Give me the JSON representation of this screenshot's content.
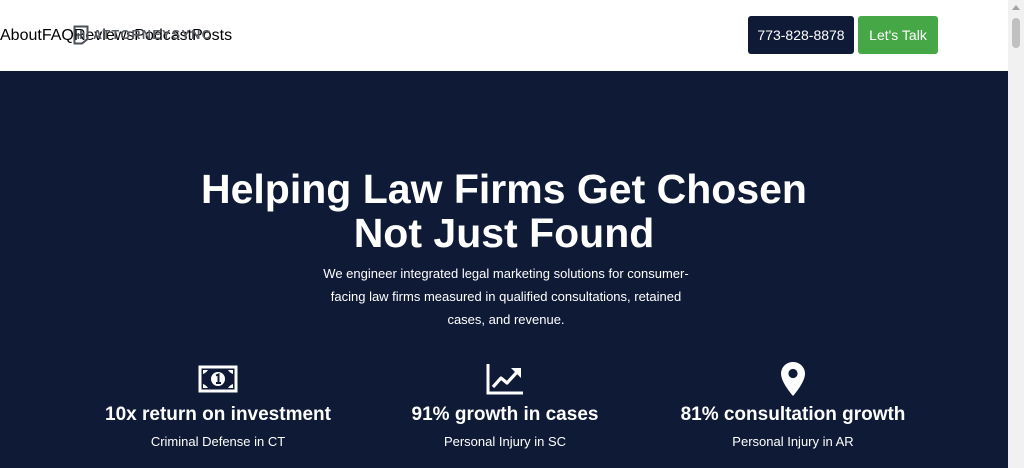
{
  "header": {
    "logo_text": "ATTORNEYSYNC",
    "nav": [
      "About",
      "FAQ",
      "Reviews",
      "Podcast",
      "Posts"
    ],
    "phone_button": "773-828-8878",
    "cta_button": "Let's Talk"
  },
  "hero": {
    "title_line1": "Helping Law Firms Get Chosen",
    "title_line2": "Not Just Found",
    "subtitle_line1": "We engineer integrated legal marketing solutions for consumer-",
    "subtitle_line2": "facing law firms measured in qualified consultations, retained",
    "subtitle_line3": "cases, and revenue."
  },
  "stats": [
    {
      "icon": "money-bill-icon",
      "value": "10x return on investment",
      "label": "Criminal Defense in CT"
    },
    {
      "icon": "chart-line-icon",
      "value": "91% growth in cases",
      "label": "Personal Injury in SC"
    },
    {
      "icon": "map-marker-icon",
      "value": "81% consultation growth",
      "label": "Personal Injury in AR"
    }
  ],
  "colors": {
    "navy": "#0f1a36",
    "green": "#46a746",
    "white": "#ffffff"
  }
}
